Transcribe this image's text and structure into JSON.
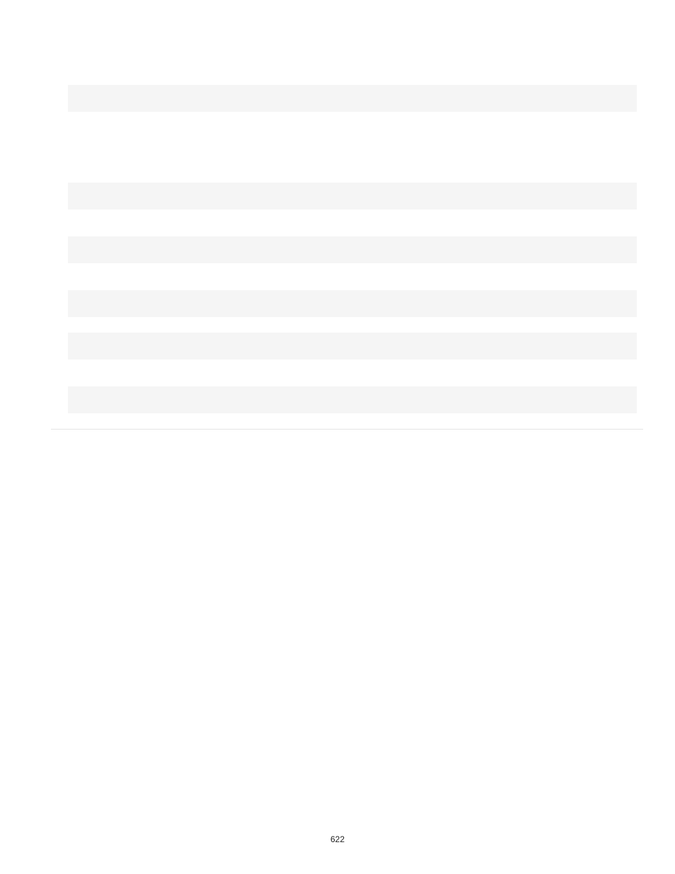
{
  "page": {
    "number": "622"
  },
  "bars": {
    "count": 6
  }
}
